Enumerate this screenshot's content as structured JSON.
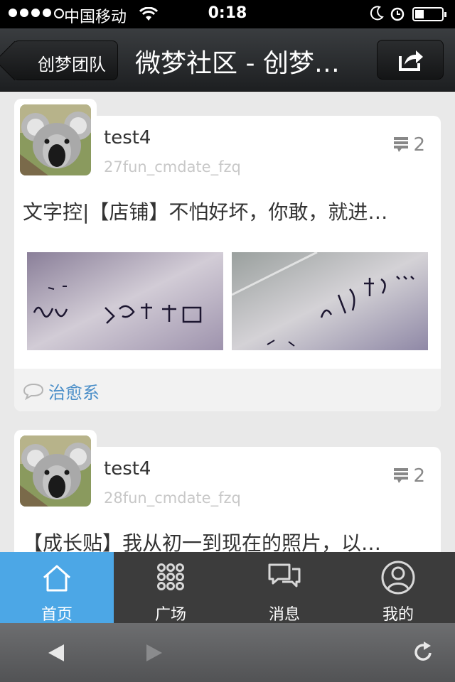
{
  "status_bar": {
    "carrier": "中国移动",
    "time": "0:18"
  },
  "nav": {
    "back_label": "创梦团队",
    "title": "微梦社区 - 创梦…"
  },
  "posts": [
    {
      "username": "test4",
      "meta": "27fun_cmdate_fzq",
      "comment_count": "2",
      "text": "文字控|【店铺】不怕好坏，你敢，就进…",
      "tag": "治愈系"
    },
    {
      "username": "test4",
      "meta": "28fun_cmdate_fzq",
      "comment_count": "2",
      "text": "【成长贴】我从初一到现在的照片，以…"
    }
  ],
  "tabs": [
    {
      "label": "首页",
      "icon": "home-icon"
    },
    {
      "label": "广场",
      "icon": "grid-icon"
    },
    {
      "label": "消息",
      "icon": "chat-icon"
    },
    {
      "label": "我的",
      "icon": "user-icon"
    }
  ],
  "colors": {
    "accent": "#4ca7e6",
    "tag": "#4a8ec8",
    "navbar": "#2a2c2e",
    "tabbar": "#3c3c3c"
  }
}
